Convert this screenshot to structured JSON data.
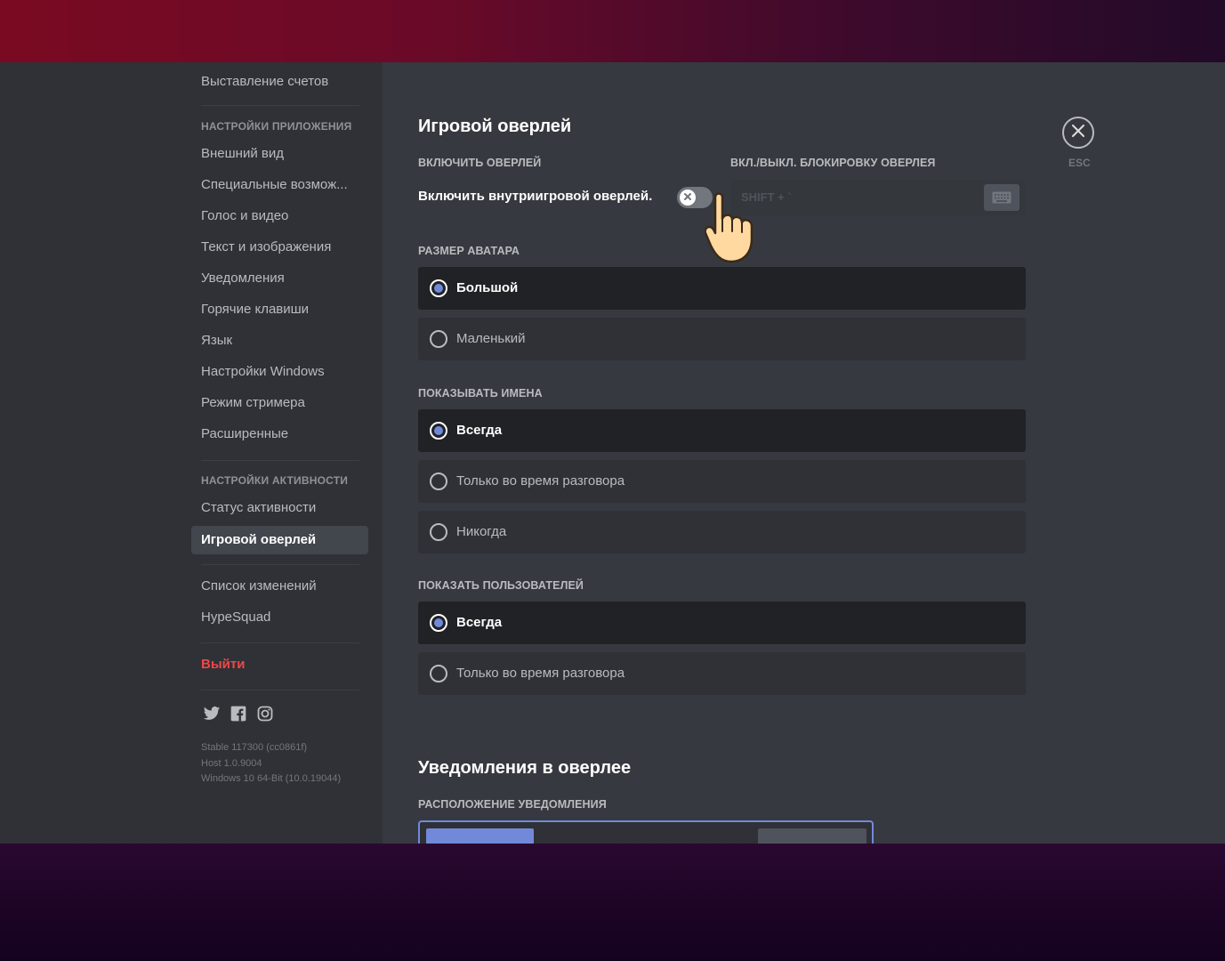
{
  "sidebar": {
    "billing": "Выставление счетов",
    "app_settings_header": "НАСТРОЙКИ ПРИЛОЖЕНИЯ",
    "app_items": [
      "Внешний вид",
      "Специальные возмож...",
      "Голос и видео",
      "Текст и изображения",
      "Уведомления",
      "Горячие клавиши",
      "Язык",
      "Настройки Windows",
      "Режим стримера",
      "Расширенные"
    ],
    "activity_header": "НАСТРОЙКИ АКТИВНОСТИ",
    "activity_items": [
      "Статус активности",
      "Игровой оверлей"
    ],
    "other_items": [
      "Список изменений",
      "HypeSquad"
    ],
    "logout": "Выйти",
    "social_icons": [
      "twitter-icon",
      "facebook-icon",
      "instagram-icon"
    ],
    "version_lines": [
      "Stable 117300 (cc0861f)",
      "Host 1.0.9004",
      "Windows 10 64-Bit (10.0.19044)"
    ]
  },
  "main": {
    "title": "Игровой оверлей",
    "enable_label": "ВКЛЮЧИТЬ ОВЕРЛЕЙ",
    "lock_label": "ВКЛ./ВЫКЛ. БЛОКИРОВКУ ОВЕРЛЕЯ",
    "toggle_text": "Включить внутриигровой оверлей.",
    "toggle_on": false,
    "keybind_text": "SHIFT + `",
    "avatar_size_label": "РАЗМЕР АВАТАРА",
    "avatar_options": [
      "Большой",
      "Маленький"
    ],
    "show_names_label": "ПОКАЗЫВАТЬ ИМЕНА",
    "names_options": [
      "Всегда",
      "Только во время разговора",
      "Никогда"
    ],
    "show_users_label": "ПОКАЗАТЬ ПОЛЬЗОВАТЕЛЕЙ",
    "users_options": [
      "Всегда",
      "Только во время разговора"
    ],
    "notifications_title": "Уведомления в оверлее",
    "notification_position_label": "РАСПОЛОЖЕНИЕ УВЕДОМЛЕНИЯ",
    "esc_label": "ESC"
  },
  "colors": {
    "accent": "#7289da",
    "danger": "#f04747",
    "sidebar_bg": "#2f3136",
    "content_bg": "#36393f"
  }
}
